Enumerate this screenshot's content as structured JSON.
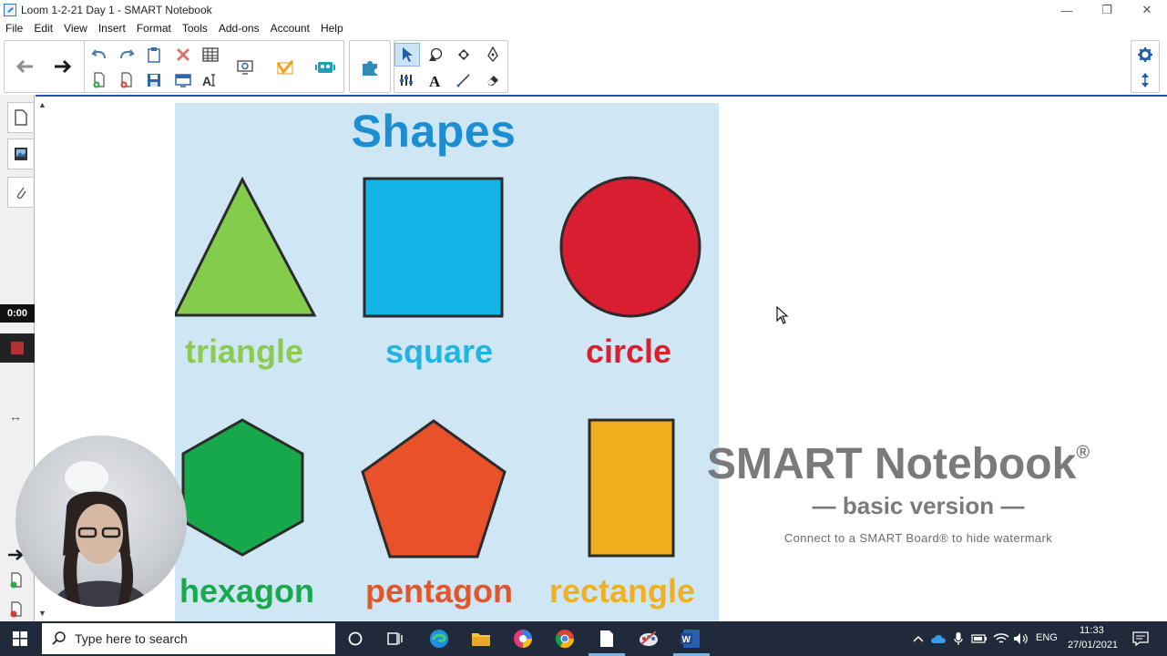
{
  "window": {
    "title": "Loom 1-2-21 Day 1 - SMART Notebook",
    "min_glyph": "—",
    "restore_glyph": "❐",
    "close_glyph": "✕"
  },
  "menu": [
    "File",
    "Edit",
    "View",
    "Insert",
    "Format",
    "Tools",
    "Add-ons",
    "Account",
    "Help"
  ],
  "sidebar": {
    "timer": "0:00"
  },
  "slide": {
    "title": "Shapes",
    "labels": {
      "triangle": "triangle",
      "square": "square",
      "circle": "circle",
      "hexagon": "hexagon",
      "pentagon": "pentagon",
      "rectangle": "rectangle"
    }
  },
  "watermark": {
    "title": "SMART Notebook",
    "registered": "®",
    "subtitle": "— basic version —",
    "note": "Connect to a SMART Board® to hide watermark"
  },
  "taskbar": {
    "search_placeholder": "Type here to search",
    "language": "ENG",
    "time": "11:33",
    "date": "27/01/2021"
  },
  "colors": {
    "triangle": "#84cc4c",
    "square": "#14b5e6",
    "circle": "#d81e30",
    "hexagon": "#16a84a",
    "pentagon": "#e8512a",
    "rectangle": "#f0ae1e",
    "title_blue": "#1d8ed1",
    "label_triangle": "#8ccb4f",
    "label_square": "#20b4e3",
    "label_circle": "#d8202f",
    "label_hexagon": "#17a94b",
    "label_pentagon": "#e2562c",
    "label_rectangle": "#f1b024"
  }
}
